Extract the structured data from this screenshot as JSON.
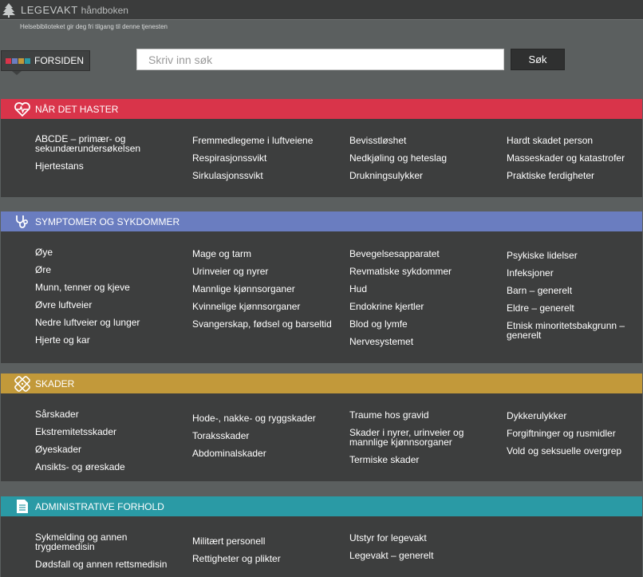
{
  "header": {
    "brand_main": "LEGEVAKT",
    "brand_sub": "håndboken",
    "subtitle": "Helsebiblioteket gir deg fri tilgang til denne tjenesten"
  },
  "nav": {
    "home_label": "FORSIDEN",
    "home_colors": [
      "#d9344a",
      "#6a7dc0",
      "#c2993a",
      "#2a9aa5"
    ]
  },
  "search": {
    "placeholder": "Skriv inn søk",
    "button_label": "Søk"
  },
  "sections": [
    {
      "title": "NÅR DET HASTER",
      "icon": "heart-pulse-icon",
      "color": "#d9344a",
      "columns": [
        [
          "ABCDE – primær- og sekundærundersøkelsen",
          "Hjertestans"
        ],
        [
          "Fremmedlegeme i luftveiene",
          "Respirasjonssvikt",
          "Sirkulasjonssvikt"
        ],
        [
          "Bevisstløshet",
          "Nedkjøling og heteslag",
          "Drukningsulykker"
        ],
        [
          "Hardt skadet person",
          "Masseskader og katastrofer",
          "Praktiske ferdigheter"
        ]
      ]
    },
    {
      "title": "SYMPTOMER OG SYKDOMMER",
      "icon": "stethoscope-icon",
      "color": "#6a7dc0",
      "columns": [
        [
          "Øye",
          "Øre",
          "Munn, tenner og kjeve",
          "Øvre luftveier",
          "Nedre luftveier og lunger",
          "Hjerte og kar"
        ],
        [
          "Mage og tarm",
          "Urinveier og nyrer",
          "Mannlige kjønnsorganer",
          "Kvinnelige kjønnsorganer",
          "Svangerskap, fødsel og barseltid"
        ],
        [
          "Bevegelsesapparatet",
          "Revmatiske sykdommer",
          "Hud",
          "Endokrine kjertler",
          "Blod og lymfe",
          "Nervesystemet"
        ],
        [
          "Psykiske lidelser",
          "Infeksjoner",
          "Barn – generelt",
          "Eldre – generelt",
          "Etnisk minoritetsbakgrunn – generelt"
        ]
      ]
    },
    {
      "title": "SKADER",
      "icon": "bandage-icon",
      "color": "#c2993a",
      "columns": [
        [
          "Sårskader",
          "Ekstremitetsskader",
          "Øyeskader",
          "Ansikts- og øreskade"
        ],
        [
          "Hode-, nakke- og ryggskader",
          "Toraksskader",
          "Abdominalskader"
        ],
        [
          "Traume hos gravid",
          "Skader i nyrer, urinveier og mannlige kjønnsorganer",
          "Termiske skader"
        ],
        [
          "Dykkerulykker",
          "Forgiftninger og rusmidler",
          "Vold og seksuelle overgrep"
        ]
      ]
    },
    {
      "title": "ADMINISTRATIVE FORHOLD",
      "icon": "document-icon",
      "color": "#2a9aa5",
      "columns": [
        [
          "Sykmelding og annen trygdemedisin",
          "Dødsfall og annen rettsmedisin"
        ],
        [
          "Militært personell",
          "Rettigheter og plikter"
        ],
        [
          "Utstyr for legevakt",
          "Legevakt – generelt"
        ],
        []
      ]
    }
  ]
}
